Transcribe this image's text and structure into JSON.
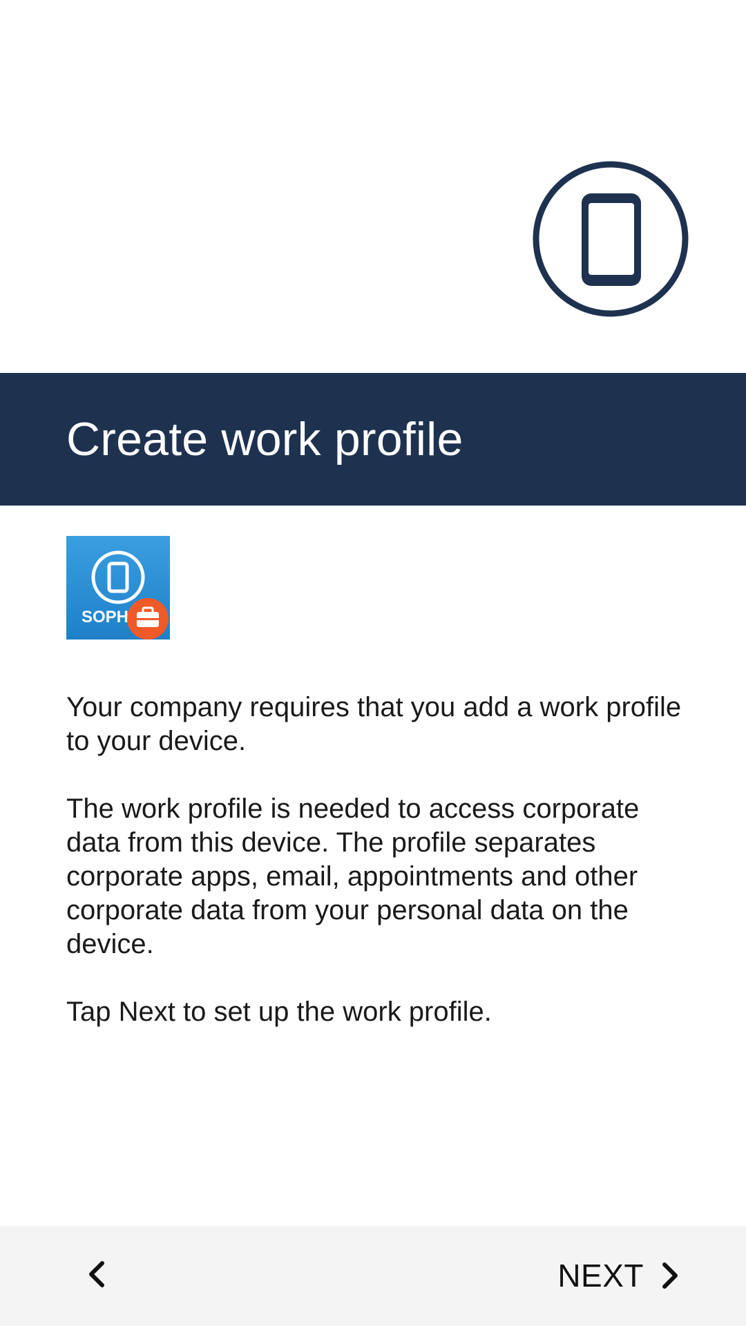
{
  "header": {
    "title": "Create work profile"
  },
  "app_icon": {
    "label": "SOPH",
    "icon": "sophos-mobile-app-icon",
    "badge_icon": "briefcase-icon",
    "colors": {
      "tile": "#2b8fd6",
      "badge": "#f05a28"
    }
  },
  "hero": {
    "icon": "smartphone-icon",
    "color": "#1e3250"
  },
  "body": {
    "paragraphs": [
      "Your company requires that you add a work profile to your device.",
      "The work profile is needed to access corporate data from this device. The profile separates corporate apps, email, appointments and other corporate data from your personal data on the device.",
      "Tap Next to set up the work profile."
    ]
  },
  "footer": {
    "back_icon": "chevron-left-icon",
    "next_label": "NEXT",
    "next_icon": "chevron-right-icon"
  },
  "colors": {
    "header_band": "#1e3250",
    "footer_bg": "#f4f4f4"
  }
}
